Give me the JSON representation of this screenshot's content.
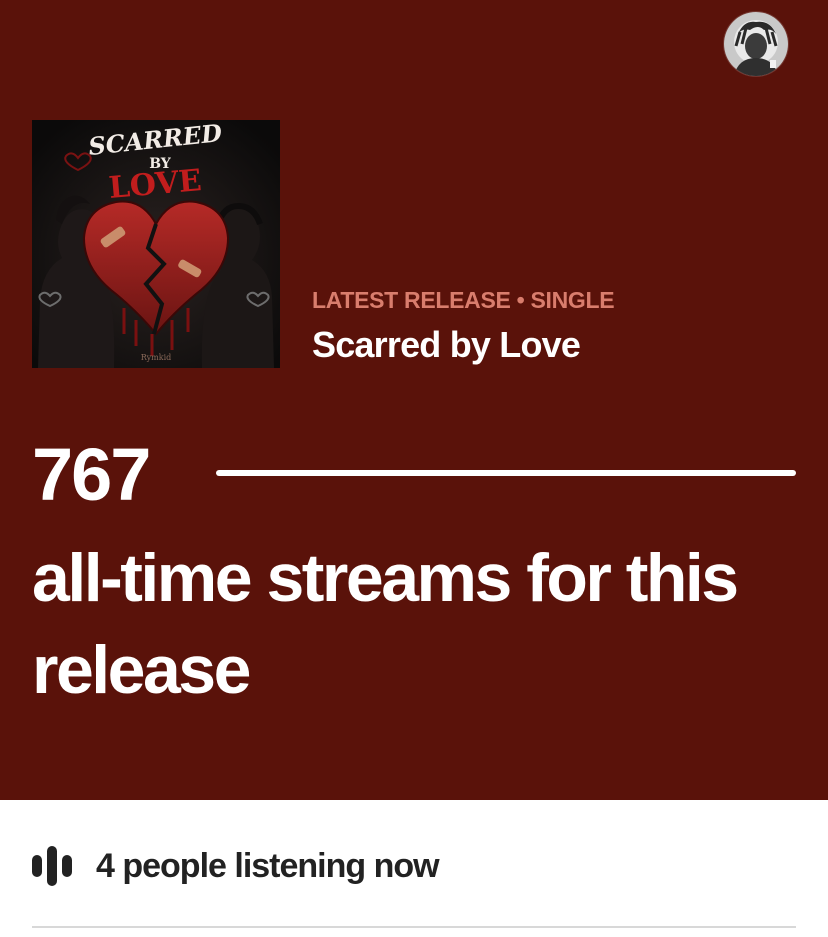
{
  "latest_release": {
    "kicker": "LATEST RELEASE • SINGLE",
    "title": "Scarred by Love",
    "cover": {
      "line1": "SCARRED",
      "line2": "BY",
      "line3": "LOVE",
      "signature": "Rymkid",
      "icon": "album-cover-art"
    }
  },
  "stats": {
    "streams": "767",
    "caption": "all-time streams for this release"
  },
  "listening": {
    "icon": "audio-bars-icon",
    "text": "4 people listening now"
  },
  "profile": {
    "icon": "profile-avatar"
  },
  "colors": {
    "hero_bg": "#5a120a",
    "kicker": "#d97d6d",
    "text_primary": "#ffffff",
    "body_text": "#222222"
  }
}
